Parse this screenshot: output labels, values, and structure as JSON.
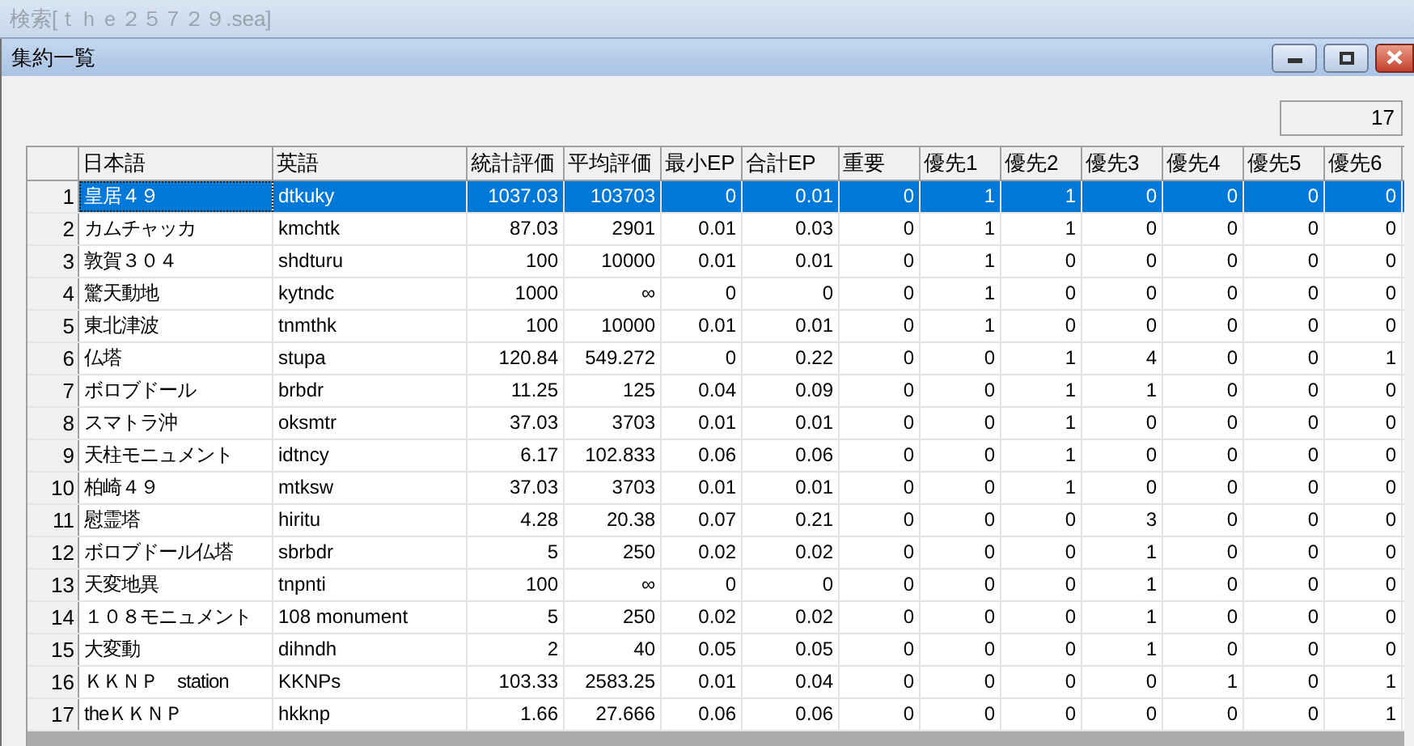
{
  "app_title": "検索[ｔｈｅ２５７２９.sea]",
  "window": {
    "title": "集約一覧"
  },
  "count": "17",
  "table": {
    "columns": [
      "日本語",
      "英語",
      "統計評価",
      "平均評価",
      "最小EP",
      "合計EP",
      "重要",
      "優先1",
      "優先2",
      "優先3",
      "優先4",
      "優先5",
      "優先6"
    ],
    "rows": [
      {
        "number": "1",
        "selected": true,
        "cells": [
          "皇居４９",
          "dtkuky",
          "1037.03",
          "103703",
          "0",
          "0.01",
          "0",
          "1",
          "1",
          "0",
          "0",
          "0",
          "0"
        ]
      },
      {
        "number": "2",
        "selected": false,
        "cells": [
          "カムチャッカ",
          "kmchtk",
          "87.03",
          "2901",
          "0.01",
          "0.03",
          "0",
          "1",
          "1",
          "0",
          "0",
          "0",
          "0"
        ]
      },
      {
        "number": "3",
        "selected": false,
        "cells": [
          "敦賀３０４",
          "shdturu",
          "100",
          "10000",
          "0.01",
          "0.01",
          "0",
          "1",
          "0",
          "0",
          "0",
          "0",
          "0"
        ]
      },
      {
        "number": "4",
        "selected": false,
        "cells": [
          "驚天動地",
          "kytndc",
          "1000",
          "∞",
          "0",
          "0",
          "0",
          "1",
          "0",
          "0",
          "0",
          "0",
          "0"
        ]
      },
      {
        "number": "5",
        "selected": false,
        "cells": [
          "東北津波",
          "tnmthk",
          "100",
          "10000",
          "0.01",
          "0.01",
          "0",
          "1",
          "0",
          "0",
          "0",
          "0",
          "0"
        ]
      },
      {
        "number": "6",
        "selected": false,
        "cells": [
          "仏塔",
          "stupa",
          "120.84",
          "549.272",
          "0",
          "0.22",
          "0",
          "0",
          "1",
          "4",
          "0",
          "0",
          "1"
        ]
      },
      {
        "number": "7",
        "selected": false,
        "cells": [
          "ボロブドール",
          "brbdr",
          "11.25",
          "125",
          "0.04",
          "0.09",
          "0",
          "0",
          "1",
          "1",
          "0",
          "0",
          "0"
        ]
      },
      {
        "number": "8",
        "selected": false,
        "cells": [
          "スマトラ沖",
          "oksmtr",
          "37.03",
          "3703",
          "0.01",
          "0.01",
          "0",
          "0",
          "1",
          "0",
          "0",
          "0",
          "0"
        ]
      },
      {
        "number": "9",
        "selected": false,
        "cells": [
          "天柱モニュメント",
          "idtncy",
          "6.17",
          "102.833",
          "0.06",
          "0.06",
          "0",
          "0",
          "1",
          "0",
          "0",
          "0",
          "0"
        ]
      },
      {
        "number": "10",
        "selected": false,
        "cells": [
          "柏崎４９",
          "mtksw",
          "37.03",
          "3703",
          "0.01",
          "0.01",
          "0",
          "0",
          "1",
          "0",
          "0",
          "0",
          "0"
        ]
      },
      {
        "number": "11",
        "selected": false,
        "cells": [
          "慰霊塔",
          "hiritu",
          "4.28",
          "20.38",
          "0.07",
          "0.21",
          "0",
          "0",
          "0",
          "3",
          "0",
          "0",
          "0"
        ]
      },
      {
        "number": "12",
        "selected": false,
        "cells": [
          "ボロブドール仏塔",
          "sbrbdr",
          "5",
          "250",
          "0.02",
          "0.02",
          "0",
          "0",
          "0",
          "1",
          "0",
          "0",
          "0"
        ]
      },
      {
        "number": "13",
        "selected": false,
        "cells": [
          "天変地異",
          "tnpnti",
          "100",
          "∞",
          "0",
          "0",
          "0",
          "0",
          "0",
          "1",
          "0",
          "0",
          "0"
        ]
      },
      {
        "number": "14",
        "selected": false,
        "cells": [
          "１０８モニュメント",
          "108 monument",
          "5",
          "250",
          "0.02",
          "0.02",
          "0",
          "0",
          "0",
          "1",
          "0",
          "0",
          "0"
        ]
      },
      {
        "number": "15",
        "selected": false,
        "cells": [
          "大変動",
          "dihndh",
          "2",
          "40",
          "0.05",
          "0.05",
          "0",
          "0",
          "0",
          "1",
          "0",
          "0",
          "0"
        ]
      },
      {
        "number": "16",
        "selected": false,
        "cells": [
          "ＫＫＮＰ　station",
          "KKNPs",
          "103.33",
          "2583.25",
          "0.01",
          "0.04",
          "0",
          "0",
          "0",
          "0",
          "1",
          "0",
          "1"
        ]
      },
      {
        "number": "17",
        "selected": false,
        "cells": [
          "theＫＫＮＰ",
          "hkknp",
          "1.66",
          "27.666",
          "0.06",
          "0.06",
          "0",
          "0",
          "0",
          "0",
          "0",
          "0",
          "1"
        ]
      }
    ]
  }
}
